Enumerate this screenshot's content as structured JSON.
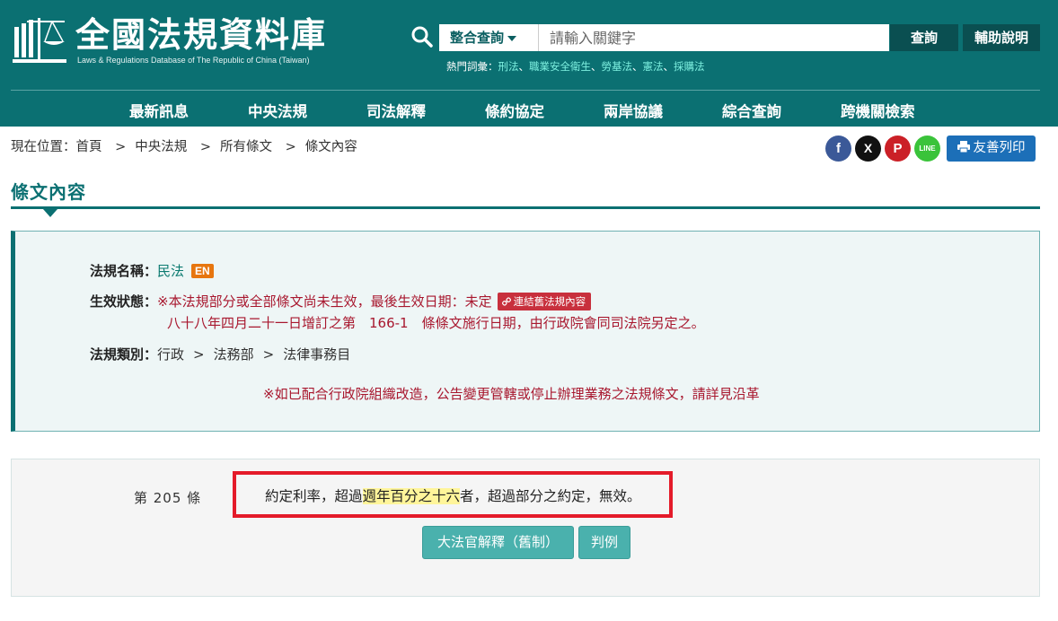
{
  "header": {
    "site_title": "全國法規資料庫",
    "site_subtitle": "Laws & Regulations Database of The Republic of China (Taiwan)",
    "search_mode": "整合查詢",
    "search_placeholder": "請輸入關鍵字",
    "search_button": "查詢",
    "help_button": "輔助說明",
    "hot_label": "熱門詞彙：",
    "hot_terms": [
      "刑法",
      "職業安全衛生",
      "勞基法",
      "憲法",
      "採購法"
    ],
    "hot_separator": "、"
  },
  "nav": {
    "items": [
      "最新訊息",
      "中央法規",
      "司法解釋",
      "條約協定",
      "兩岸協議",
      "綜合查詢",
      "跨機關檢索"
    ]
  },
  "breadcrumb": {
    "prefix": "現在位置：",
    "items": [
      "首頁",
      "中央法規",
      "所有條文",
      "條文內容"
    ],
    "separator": ">"
  },
  "share": {
    "facebook": "f",
    "x": "X",
    "pinterest": "P",
    "line": "LINE",
    "print_label": "友善列印",
    "colors": {
      "facebook": "#3b5998",
      "x": "#111111",
      "pinterest": "#cb2027",
      "line": "#3ac33a"
    }
  },
  "section_title": "條文內容",
  "info": {
    "name_label": "法規名稱：",
    "name_value": "民法",
    "en_badge": "EN",
    "status_label": "生效狀態：",
    "status_line1": "※本法規部分或全部條文尚未生效，最後生效日期：未定",
    "old_link": "連結舊法規內容",
    "status_line2": "八十八年四月二十一日增訂之第　166-1　條條文施行日期，由行政院會同司法院另定之。",
    "category_label": "法規類別：",
    "category_items": [
      "行政",
      "法務部",
      "法律事務目"
    ],
    "category_separator": ">",
    "notice": "※如已配合行政院組織改造，公告變更管轄或停止辦理業務之法規條文，請詳見沿革"
  },
  "article": {
    "number": "第 205 條",
    "text_before": "約定利率，超過",
    "text_highlight": "週年百分之十六",
    "text_after": "者，超過部分之約定，無效。",
    "buttons": [
      "大法官解釋（舊制）",
      "判例"
    ]
  }
}
